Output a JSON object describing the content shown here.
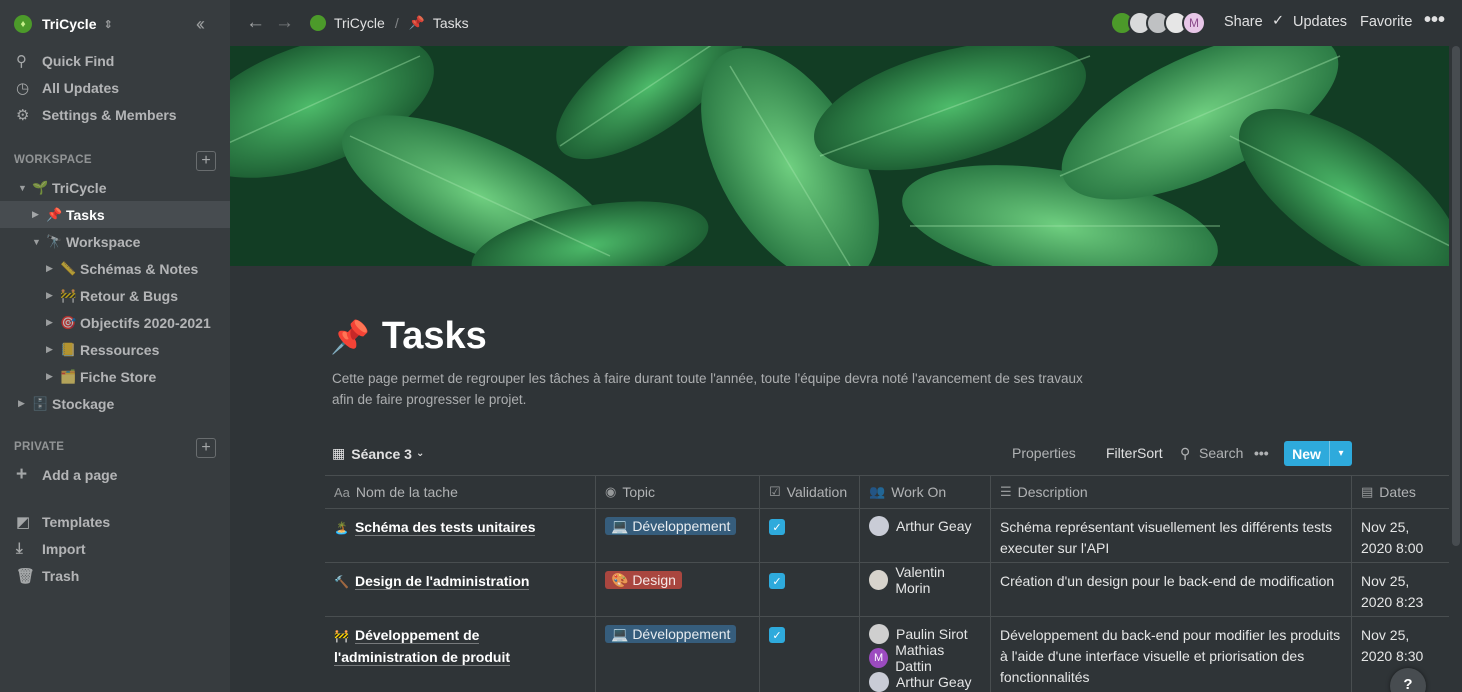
{
  "workspace": {
    "name": "TriCycle"
  },
  "sidebar": {
    "quick_find": "Quick Find",
    "all_updates": "All Updates",
    "settings": "Settings & Members",
    "workspace_section": "WORKSPACE",
    "private_section": "PRIVATE",
    "add_page": "Add a page",
    "templates": "Templates",
    "import": "Import",
    "trash": "Trash",
    "tree": [
      {
        "label": "TriCycle",
        "emoji": "🌱"
      },
      {
        "label": "Tasks",
        "emoji": "📌"
      },
      {
        "label": "Workspace",
        "emoji": "🔭"
      },
      {
        "label": "Schémas & Notes",
        "emoji": "📏"
      },
      {
        "label": "Retour & Bugs",
        "emoji": "🚧"
      },
      {
        "label": "Objectifs 2020-2021",
        "emoji": "🎯"
      },
      {
        "label": "Ressources",
        "emoji": "📒"
      },
      {
        "label": "Fiche Store",
        "emoji": "🗂️"
      },
      {
        "label": "Stockage",
        "emoji": "🗄️"
      }
    ]
  },
  "topbar": {
    "crumb_workspace": "TriCycle",
    "crumb_sep": "/",
    "crumb_page": "Tasks",
    "crumb_page_emoji": "📌",
    "share": "Share",
    "updates": "Updates",
    "favorite": "Favorite",
    "avatar_letter": "M"
  },
  "page": {
    "emoji": "📌",
    "title": "Tasks",
    "description": "Cette page permet de regrouper les tâches à faire durant toute l'année, toute l'équipe devra noté l'avancement de ses travaux afin de faire progresser le projet."
  },
  "view": {
    "name": "Séance 3",
    "properties": "Properties",
    "filter": "Filter",
    "sort": "Sort",
    "search": "Search",
    "new": "New"
  },
  "table": {
    "columns": [
      "Nom de la tache",
      "Topic",
      "Validation",
      "Work On",
      "Description",
      "Dates"
    ],
    "rows": [
      {
        "emoji": "🏝️",
        "name": "Schéma des tests unitaires",
        "topic": "💻 Développement",
        "validated": true,
        "people": [
          {
            "name": "Arthur Geay",
            "initial": ""
          }
        ],
        "description": "Schéma représentant visuellement les différents tests executer sur l'API",
        "date": "Nov 25, 2020 8:00"
      },
      {
        "emoji": "🔨",
        "name": "Design de l'administration",
        "topic": "🎨 Design",
        "validated": true,
        "people": [
          {
            "name": "Valentin Morin",
            "initial": ""
          }
        ],
        "description": "Création d'un design pour le back-end de modification",
        "date": "Nov 25, 2020 8:23"
      },
      {
        "emoji": "🚧",
        "name": "Développement de l'administration de produit",
        "topic": "💻 Développement",
        "validated": true,
        "people": [
          {
            "name": "Paulin Sirot",
            "initial": ""
          },
          {
            "name": "Mathias Dattin",
            "initial": "M"
          },
          {
            "name": "Arthur Geay",
            "initial": ""
          }
        ],
        "description": "Développement du back-end pour modifier les produits à l'aide d'une interface visuelle et priorisation des fonctionnalités",
        "date": "Nov 25, 2020 8:30"
      }
    ]
  },
  "help": "?",
  "colors": {
    "accent": "#2eaadc",
    "sidebar": "#373c3f",
    "bg": "#2f3437",
    "dev_tag": "#365d7c",
    "design_tag": "#a9463f"
  }
}
